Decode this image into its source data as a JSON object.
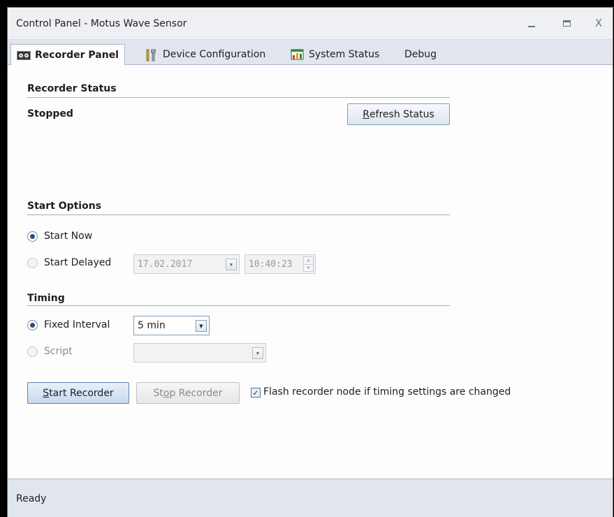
{
  "window": {
    "title": "Control Panel - Motus Wave Sensor",
    "controls": {
      "minimize": "minimize",
      "maximize": "maximize",
      "close": "X"
    }
  },
  "tabs": [
    {
      "label": "Recorder Panel",
      "icon": "recorder-icon",
      "active": true
    },
    {
      "label": "Device Configuration",
      "icon": "tools-icon",
      "active": false
    },
    {
      "label": "System Status",
      "icon": "status-icon",
      "active": false
    },
    {
      "label": "Debug",
      "icon": "",
      "active": false
    }
  ],
  "recorder_status": {
    "heading": "Recorder Status",
    "state": "Stopped",
    "refresh_button": {
      "prefix": "",
      "underlined": "R",
      "rest": "efresh Status"
    }
  },
  "start_options": {
    "heading": "Start Options",
    "start_now": {
      "label": "Start Now",
      "checked": true
    },
    "start_delayed": {
      "label": "Start Delayed",
      "checked": false,
      "date": "17.02.2017",
      "time": "10:40:23"
    }
  },
  "timing": {
    "heading": "Timing",
    "fixed_interval": {
      "label": "Fixed Interval",
      "checked": true,
      "value": "5 min"
    },
    "script": {
      "label": "Script",
      "checked": false,
      "value": ""
    }
  },
  "actions": {
    "start_button": {
      "prefix": "",
      "underlined": "S",
      "rest": "tart Recorder"
    },
    "stop_button": {
      "prefix": "St",
      "underlined": "o",
      "rest": "p Recorder"
    },
    "flash_checkbox": {
      "label": "Flash recorder node if timing settings are changed",
      "checked": true
    }
  },
  "statusbar": {
    "text": "Ready"
  }
}
